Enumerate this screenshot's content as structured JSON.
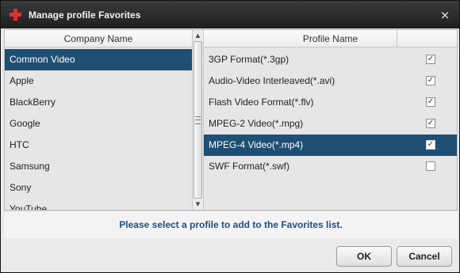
{
  "window": {
    "title": "Manage profile Favorites",
    "close_glyph": "×",
    "icon": "red-plus-icon"
  },
  "companies": {
    "header": "Company Name",
    "items": [
      {
        "label": "Common Video",
        "selected": true
      },
      {
        "label": "Apple",
        "selected": false
      },
      {
        "label": "BlackBerry",
        "selected": false
      },
      {
        "label": "Google",
        "selected": false
      },
      {
        "label": "HTC",
        "selected": false
      },
      {
        "label": "Samsung",
        "selected": false
      },
      {
        "label": "Sony",
        "selected": false
      },
      {
        "label": "YouTube",
        "selected": false
      }
    ]
  },
  "profiles": {
    "header": "Profile Name",
    "items": [
      {
        "label": "3GP Format(*.3gp)",
        "checked": true,
        "selected": false
      },
      {
        "label": "Audio-Video Interleaved(*.avi)",
        "checked": true,
        "selected": false
      },
      {
        "label": "Flash Video Format(*.flv)",
        "checked": true,
        "selected": false
      },
      {
        "label": "MPEG-2 Video(*.mpg)",
        "checked": true,
        "selected": false
      },
      {
        "label": "MPEG-4 Video(*.mp4)",
        "checked": true,
        "selected": true
      },
      {
        "label": "SWF Format(*.swf)",
        "checked": false,
        "selected": false
      }
    ]
  },
  "hint": "Please select a profile to add to the Favorites list.",
  "buttons": {
    "ok": "OK",
    "cancel": "Cancel"
  },
  "colors": {
    "selection": "#1f4f73",
    "hint_text": "#1d4f80",
    "title_bar": "#2b2b2b",
    "icon_red": "#e03030"
  }
}
